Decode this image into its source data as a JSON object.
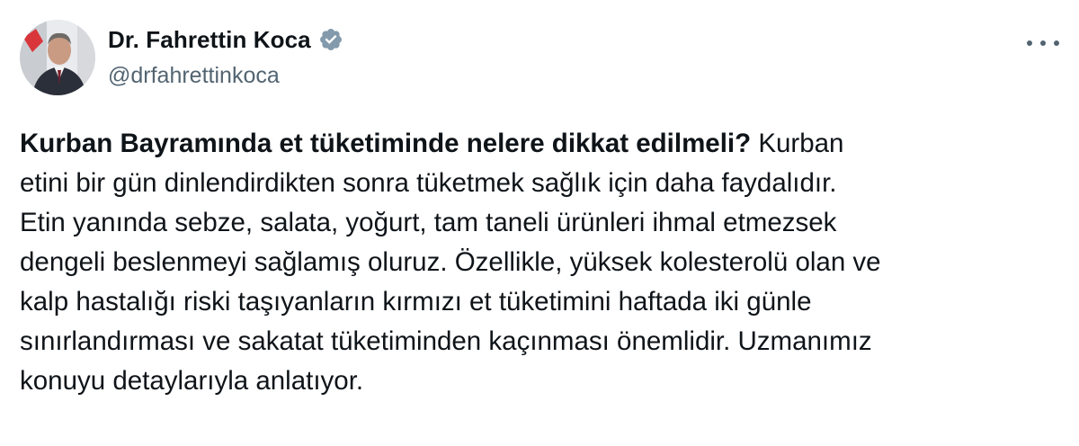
{
  "author": {
    "display_name": "Dr. Fahrettin Koca",
    "handle": "@drfahrettinkoca",
    "verified": true,
    "avatar_icon": "profile-photo",
    "badge_color": "#829aab"
  },
  "menu": {
    "icon": "more-horizontal-icon"
  },
  "tweet": {
    "headline": "Kurban Bayramında et tüketiminde nelere dikkat edilmeli?",
    "text": " Kurban\netini bir gün dinlendirdikten sonra tüketmek sağlık için daha faydalıdır.\nEtin yanında sebze, salata, yoğurt, tam taneli ürünleri ihmal etmezsek\ndengeli beslenmeyi sağlamış oluruz. Özellikle, yüksek kolesterolü olan ve\nkalp hastalığı riski taşıyanların kırmızı et tüketimini haftada iki günle\nsınırlandırması ve sakatat tüketiminden kaçınması önemlidir. Uzmanımız\nkonuyu detaylarıyla anlatıyor."
  }
}
